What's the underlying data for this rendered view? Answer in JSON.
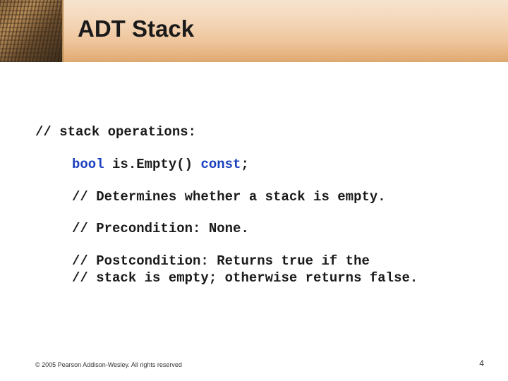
{
  "title": "ADT Stack",
  "code": {
    "l1": "// stack operations:",
    "sig_kw1": "bool",
    "sig_mid": " is.Empty() ",
    "sig_kw2": "const",
    "sig_end": ";",
    "c1": "// Determines whether a stack is empty.",
    "c2": "// Precondition: None.",
    "c3": "// Postcondition: Returns true if the",
    "c4": "// stack is empty; otherwise returns false."
  },
  "footer": "© 2005 Pearson Addison-Wesley. All rights reserved",
  "pageNumber": "4"
}
